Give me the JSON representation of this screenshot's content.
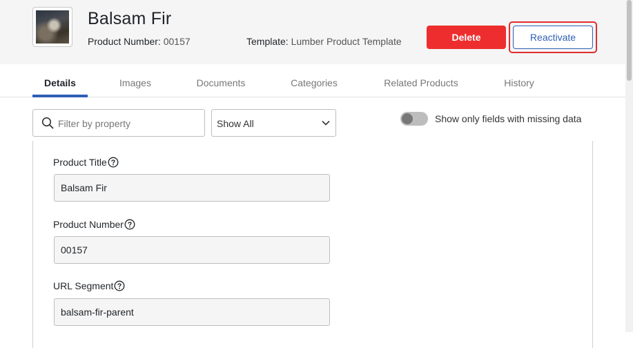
{
  "product": {
    "title": "Balsam Fir",
    "number_label": "Product Number:",
    "number_value": "00157",
    "template_label": "Template:",
    "template_value": "Lumber Product Template"
  },
  "actions": {
    "delete_label": "Delete",
    "reactivate_label": "Reactivate"
  },
  "tabs": [
    {
      "label": "Details",
      "active": true
    },
    {
      "label": "Images"
    },
    {
      "label": "Documents"
    },
    {
      "label": "Categories"
    },
    {
      "label": "Related Products"
    },
    {
      "label": "History"
    }
  ],
  "filter": {
    "placeholder": "Filter by property",
    "select_value": "Show All"
  },
  "toggle": {
    "label": "Show only fields with missing data",
    "on": false
  },
  "fields": [
    {
      "label": "Product Title",
      "value": "Balsam Fir"
    },
    {
      "label": "Product Number",
      "value": "00157"
    },
    {
      "label": "URL Segment",
      "value": "balsam-fir-parent"
    }
  ],
  "colors": {
    "accent": "#2e5fb6",
    "danger": "#ee2e2e",
    "header_bg": "#f5f5f5"
  },
  "icons": {
    "search": "search-icon",
    "help": "help-circle-icon",
    "dropdown": "chevron-down-icon"
  }
}
